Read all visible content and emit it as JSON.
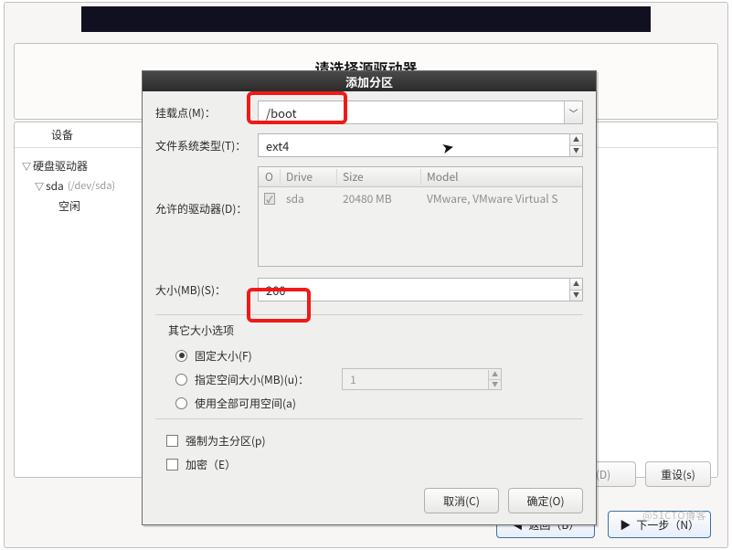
{
  "dialog": {
    "title": "添加分区",
    "mount_label": "挂载点(M)：",
    "mount_value": "/boot",
    "fs_label": "文件系统类型(T)：",
    "fs_value": "ext4",
    "drives_label": "允许的驱动器(D)：",
    "drives_table": {
      "head_chk": "O",
      "head_drive": "Drive",
      "head_size": "Size",
      "head_model": "Model",
      "row": {
        "checked": true,
        "drive": "sda",
        "size": "20480 MB",
        "model": "VMware, VMware Virtual S"
      }
    },
    "size_label": "大小(MB)(S)：",
    "size_value": "200",
    "extra_title": "其它大小选项",
    "radio_fixed": "固定大小(F)",
    "radio_upto": "指定空间大小(MB)(u)：",
    "radio_upto_value": "1",
    "radio_fill": "使用全部可用空间(a)",
    "chk_primary": "强制为主分区(p)",
    "chk_encrypt": "加密（E）",
    "btn_cancel": "取消(C)",
    "btn_ok": "确定(O)"
  },
  "bg": {
    "hidden_title": "请选择源驱动器",
    "device_header": "设备",
    "tree": {
      "root": "硬盘驱动器",
      "child": "sda",
      "child_hint": "(/dev/sda)",
      "leaf": "空闲"
    },
    "btn_d": "(D)",
    "btn_reset": "重设(s)",
    "btn_back": "返回（B）",
    "btn_next": "下一步（N）"
  },
  "watermark": "@51CTO博客"
}
